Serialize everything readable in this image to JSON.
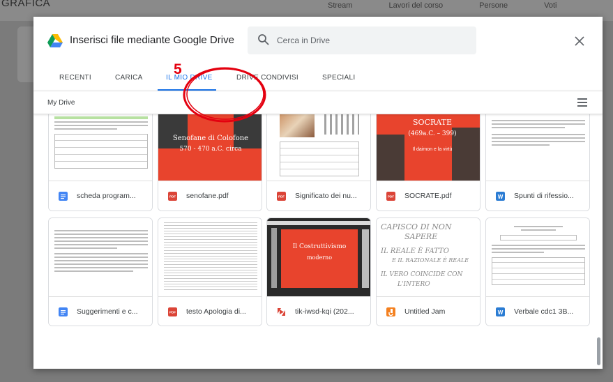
{
  "background": {
    "page_title": "GRAFICA",
    "tabs": [
      "Stream",
      "Lavori del corso",
      "Persone",
      "Voti"
    ]
  },
  "dialog": {
    "title": "Inserisci file mediante Google Drive",
    "search": {
      "placeholder": "Cerca in Drive",
      "value": ""
    },
    "tabs": [
      {
        "label": "RECENTI",
        "active": false
      },
      {
        "label": "CARICA",
        "active": false
      },
      {
        "label": "IL MIO DRIVE",
        "active": true
      },
      {
        "label": "DRIVE CONDIVISI",
        "active": false
      },
      {
        "label": "SPECIALI",
        "active": false
      }
    ],
    "breadcrumb": "My Drive",
    "files": [
      {
        "name": "scheda program...",
        "type": "doc"
      },
      {
        "name": "senofane.pdf",
        "type": "pdf"
      },
      {
        "name": "Significato dei nu...",
        "type": "pdf"
      },
      {
        "name": "SOCRATE.pdf",
        "type": "pdf"
      },
      {
        "name": "Spunti di rifessio...",
        "type": "word"
      },
      {
        "name": "Suggerimenti e c...",
        "type": "doc"
      },
      {
        "name": "testo Apologia di...",
        "type": "pdf"
      },
      {
        "name": "tik-iwsd-kqi (202...",
        "type": "video"
      },
      {
        "name": "Untitled Jam",
        "type": "jam"
      },
      {
        "name": "Verbale cdc1 3B...",
        "type": "word"
      }
    ],
    "thumbnails": {
      "senofane_title": "Senofane di Colofone",
      "senofane_dates": "570 - 470 a.C. circa",
      "socrate_title": "SOCRATE",
      "socrate_dates": "(469a.C. – 399)",
      "socrate_sub": "Il daimon e la virtù",
      "tik_title": "Il Costruttivismo",
      "tik_sub": "moderno",
      "jam_line1": "CAPISCO DI NON",
      "jam_line2": "SAPERE",
      "jam_line3": "IL REALE È FATTO",
      "jam_line4": "E IL RAZIONALE È REALE",
      "jam_line5": "IL VERO COINCIDE CON",
      "jam_line6": "L'INTERO"
    }
  },
  "annotation": {
    "step_number": "5",
    "color": "#e4000f"
  },
  "colors": {
    "accent": "#1a73e8",
    "pdf_red": "#db4437",
    "doc_blue": "#4285f4",
    "word_blue": "#2b7cd3",
    "jam_orange": "#f4801f"
  }
}
